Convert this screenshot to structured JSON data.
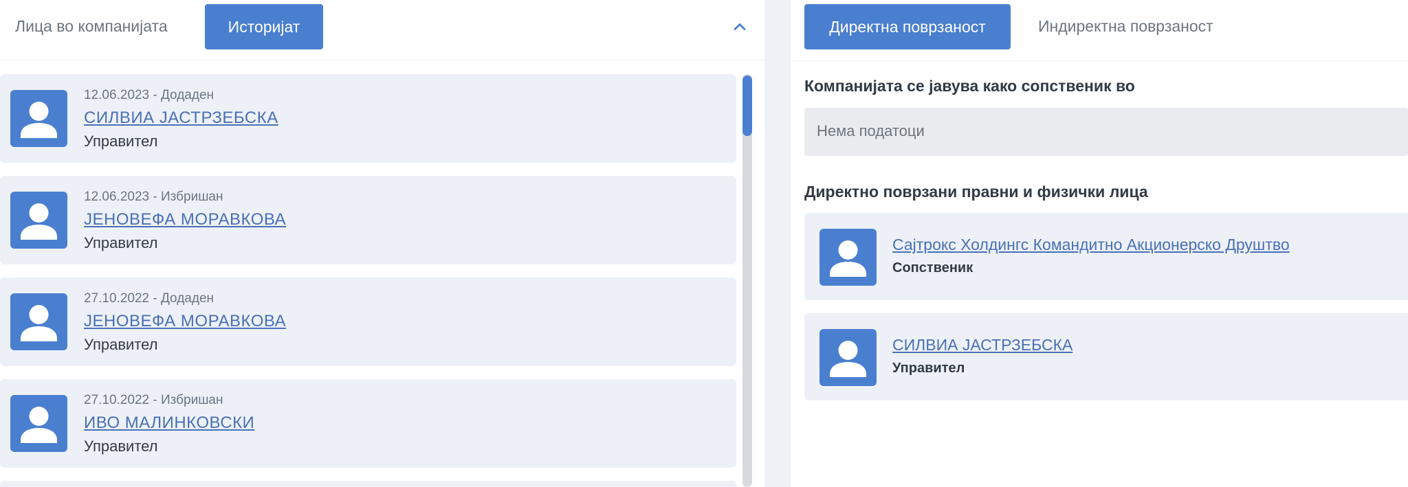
{
  "left_panel": {
    "tab_people": "Лица во компанијата",
    "tab_history": "Историјат",
    "history": [
      {
        "meta": "12.06.2023 - Додаден",
        "name": "СИЛВИА ЈАСТРЗЕБСКА",
        "role": "Управител"
      },
      {
        "meta": "12.06.2023 - Избришан",
        "name": "ЈЕНОВЕФА МОРАВКОВА",
        "role": "Управител"
      },
      {
        "meta": "27.10.2022 - Додаден",
        "name": "ЈЕНОВЕФА МОРАВКОВА",
        "role": "Управител"
      },
      {
        "meta": "27.10.2022 - Избришан",
        "name": "ИВО МАЛИНКОВСКИ",
        "role": "Управител"
      }
    ]
  },
  "right_panel": {
    "tab_direct": "Директна поврзаност",
    "tab_indirect": "Индиректна поврзаност",
    "owner_heading": "Компанијата се јавува како сопственик во",
    "no_data": "Нема податоци",
    "direct_heading": "Директно поврзани правни и физички лица",
    "connections": [
      {
        "name": "Сајтрокс Холдингс Командитно Акционерско Друштво",
        "role": "Сопственик"
      },
      {
        "name": "СИЛВИА ЈАСТРЗЕБСКА",
        "role": "Управител"
      }
    ]
  },
  "colors": {
    "accent": "#4a7fd0",
    "card_bg": "#edf1f7",
    "link": "#4a6fb5"
  },
  "icons": {
    "avatar": "user-avatar-icon",
    "collapse": "chevron-up-icon"
  }
}
